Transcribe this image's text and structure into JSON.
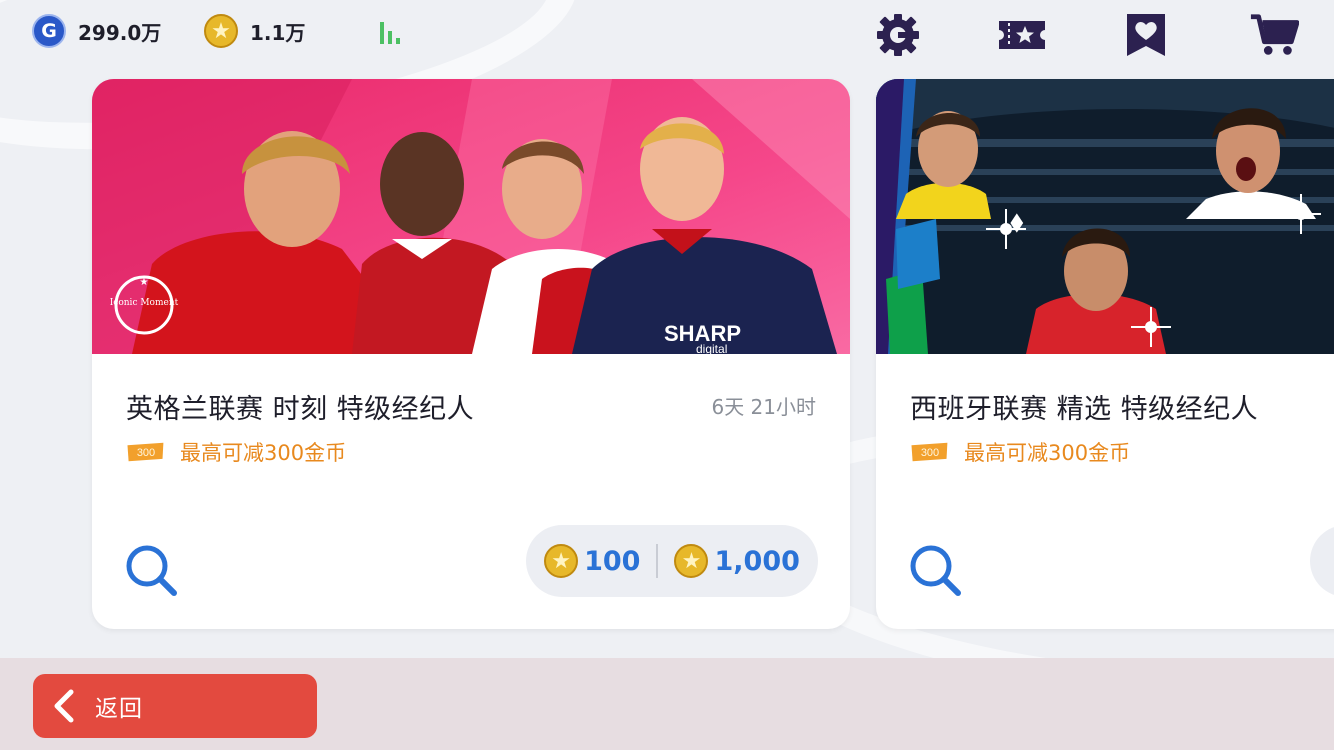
{
  "currencies": {
    "gp": {
      "icon": "gp-coin-icon",
      "letter": "G",
      "value": "299.0万"
    },
    "coins": {
      "icon": "star-coin-icon",
      "value": "1.1万"
    }
  },
  "header_icons": [
    "gear-icon",
    "ticket-icon",
    "heart-bookmark-icon",
    "cart-icon"
  ],
  "cards": [
    {
      "title": "英格兰联赛 时刻 特级经纪人",
      "timer": "6天 21小时",
      "discount": "最高可减300金币",
      "ticket_label": "300",
      "banner_badge": "Iconic Moment",
      "banner_sponsor": "SHARP",
      "banner_sponsor_sub": "digital",
      "prices": [
        "100",
        "1,000"
      ]
    },
    {
      "title": "西班牙联赛 精选 特级经纪人",
      "discount": "最高可减300金币",
      "ticket_label": "300"
    }
  ],
  "footer": {
    "back_label": "返回"
  },
  "colors": {
    "pink_banner": "#f2387a",
    "accent_blue": "#2a72d6",
    "discount_orange": "#e8891e",
    "back_red": "#e34a3f"
  }
}
